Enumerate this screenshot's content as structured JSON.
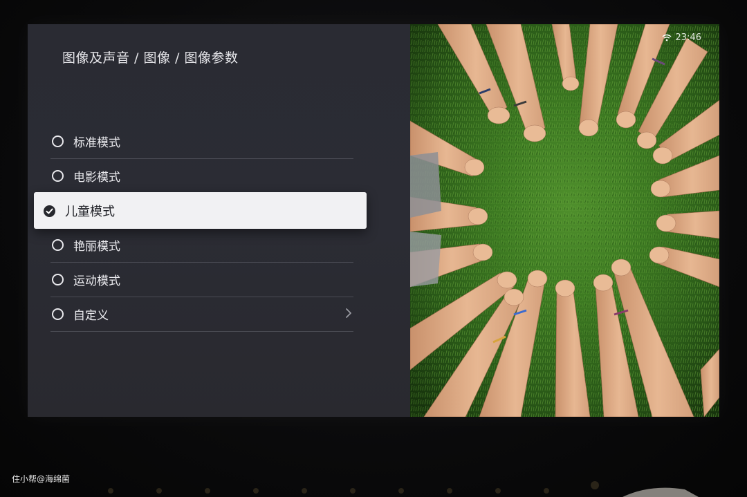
{
  "settings": {
    "breadcrumb": "图像及声音 / 图像 / 图像参数",
    "items": [
      {
        "label": "标准模式",
        "selected": false
      },
      {
        "label": "电影模式",
        "selected": false
      },
      {
        "label": "儿童模式",
        "selected": true
      },
      {
        "label": "艳丽模式",
        "selected": false
      },
      {
        "label": "运动模式",
        "selected": false
      },
      {
        "label": "自定义",
        "selected": false,
        "has_submenu": true
      }
    ]
  },
  "status_bar": {
    "time": "23:46",
    "icon": "wifi-icon"
  },
  "photo": {
    "subject": "hands-and-feet-circle-on-grass"
  },
  "watermark": {
    "text": "住小帮@海绵菌"
  },
  "colors": {
    "panel_bg": "#2b2c34",
    "selected_bg": "#f1f1f3",
    "text": "#ececf0",
    "divider": "#4a4b54"
  }
}
